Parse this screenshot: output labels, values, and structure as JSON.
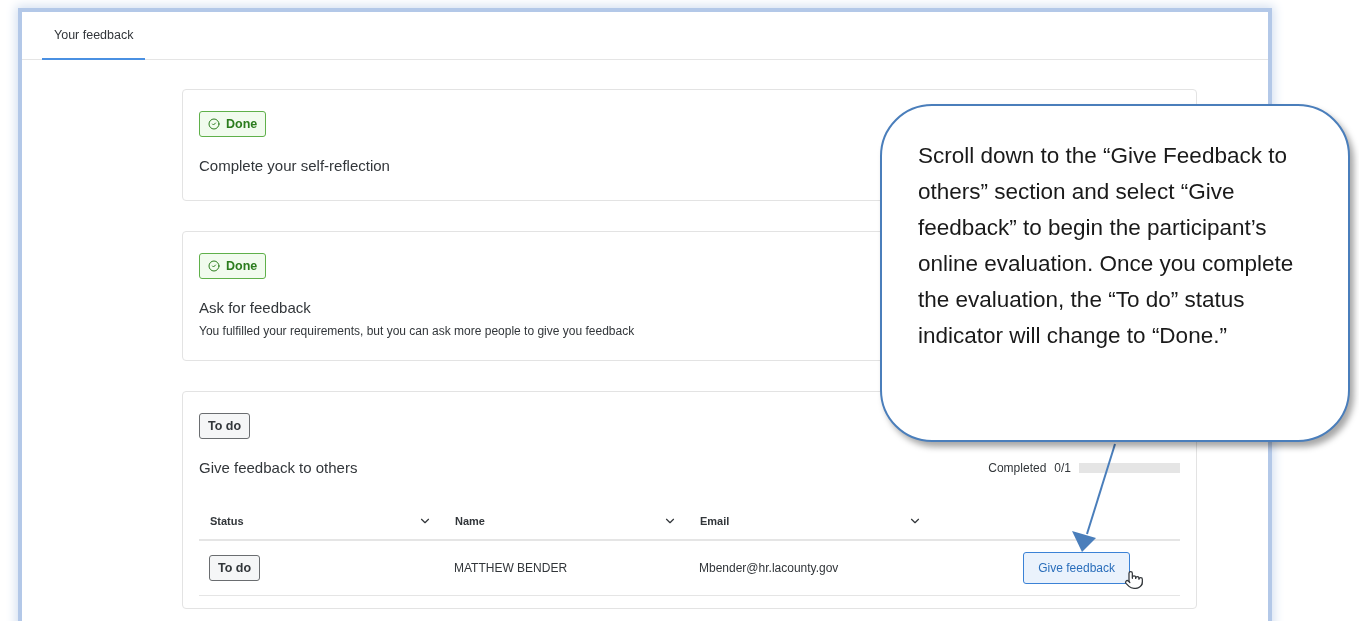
{
  "tabs": [
    {
      "label": "Your feedback",
      "selected": true
    }
  ],
  "tasks": [
    {
      "status": {
        "kind": "done",
        "label": "Done"
      },
      "title": "Complete your self-reflection"
    },
    {
      "status": {
        "kind": "done",
        "label": "Done"
      },
      "title": "Ask for feedback",
      "description": "You fulfilled your requirements, but you can ask more people to give you feedback"
    },
    {
      "status": {
        "kind": "todo",
        "label": "To do"
      },
      "title": "Give feedback to others",
      "progress": {
        "label": "Completed",
        "count": "0/1",
        "level": 0
      },
      "table": {
        "columns": [
          "Status",
          "Name",
          "Email"
        ],
        "rows": [
          {
            "status": {
              "kind": "todo",
              "label": "To do"
            },
            "name": "MATTHEW BENDER",
            "email": "Mbender@hr.lacounty.gov",
            "action": "Give feedback"
          }
        ]
      }
    }
  ],
  "callout": {
    "text": "Scroll down to the “Give Feedback to others” section and select “Give feedback” to begin the participant’s online evaluation. Once you complete the evaluation, the “To do” status indicator will change to “Done.”"
  }
}
